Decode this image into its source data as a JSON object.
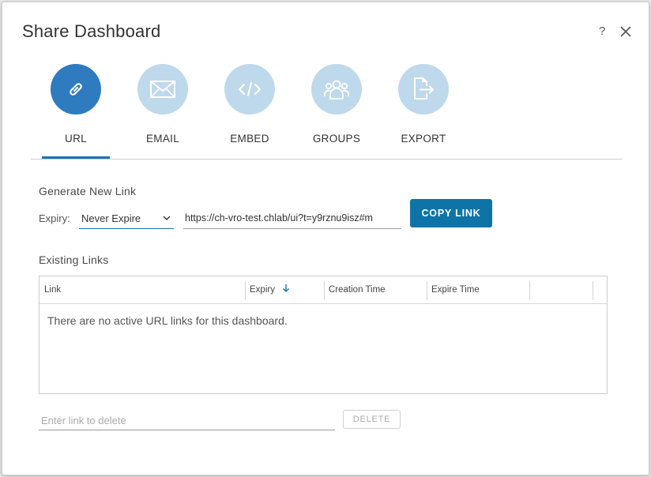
{
  "dialog": {
    "title": "Share Dashboard",
    "help_label": "?"
  },
  "tabs": [
    {
      "label": "URL",
      "icon": "link-icon",
      "active": true
    },
    {
      "label": "EMAIL",
      "icon": "envelope-icon",
      "active": false
    },
    {
      "label": "EMBED",
      "icon": "code-icon",
      "active": false
    },
    {
      "label": "GROUPS",
      "icon": "people-icon",
      "active": false
    },
    {
      "label": "EXPORT",
      "icon": "export-icon",
      "active": false
    }
  ],
  "generate": {
    "title": "Generate New Link",
    "expiry_label": "Expiry:",
    "expiry_value": "Never Expire",
    "url": "https://ch-vro-test.chlab/ui?t=y9rznu9isz#m",
    "copy_button": "COPY LINK"
  },
  "existing": {
    "title": "Existing Links",
    "columns": [
      "Link",
      "Expiry",
      "Creation Time",
      "Expire Time"
    ],
    "sort_column": "Expiry",
    "empty_message": "There are no active URL links for this dashboard."
  },
  "delete": {
    "placeholder": "Enter link to delete",
    "button": "DELETE"
  },
  "colors": {
    "accent": "#0e74a8",
    "tab_active": "#2f7bbf",
    "tab_inactive": "#bfd9ec"
  }
}
